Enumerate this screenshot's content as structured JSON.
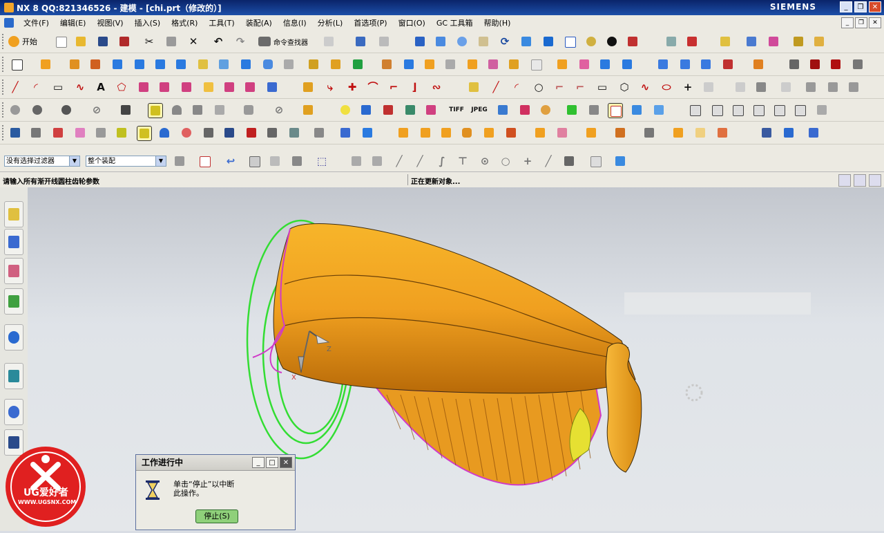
{
  "window": {
    "title": "NX 8   QQ:821346526 - 建模 - [chi.prt（修改的）]",
    "brand": "SIEMENS",
    "controls": [
      "_",
      "❐",
      "✕"
    ]
  },
  "menubar": {
    "items": [
      "文件(F)",
      "编辑(E)",
      "视图(V)",
      "插入(S)",
      "格式(R)",
      "工具(T)",
      "装配(A)",
      "信息(I)",
      "分析(L)",
      "首选项(P)",
      "窗口(O)",
      "GC 工具箱",
      "帮助(H)"
    ],
    "mdi_controls": [
      "_",
      "❐",
      "✕"
    ]
  },
  "toolbar": {
    "start_label": "开始",
    "command_finder_label": "命令查找器",
    "text_tool": "A",
    "tiff_label": "TIFF",
    "jpeg_label": "JPEG"
  },
  "selection": {
    "filter_value": "没有选择过滤器",
    "scope_value": "整个装配"
  },
  "cue_line": "请输入所有渐开线圆柱齿轮参数",
  "status_line": "正在更新对象...",
  "dialog": {
    "title": "工作进行中",
    "message_line1": "单击“停止”以中断",
    "message_line2": "此操作。",
    "stop_button": "停止(S)"
  },
  "watermark": {
    "text": "UG爱好者",
    "url": "WWW.UGSNX.COM"
  },
  "viewport": {
    "axis_labels": [
      "Z",
      "X"
    ]
  },
  "colors": {
    "title_bar": "#0a246a",
    "model_fill": "#f0a020",
    "curve_green": "#33dd33",
    "curve_magenta": "#d03ac8",
    "logo_red": "#e02020"
  }
}
